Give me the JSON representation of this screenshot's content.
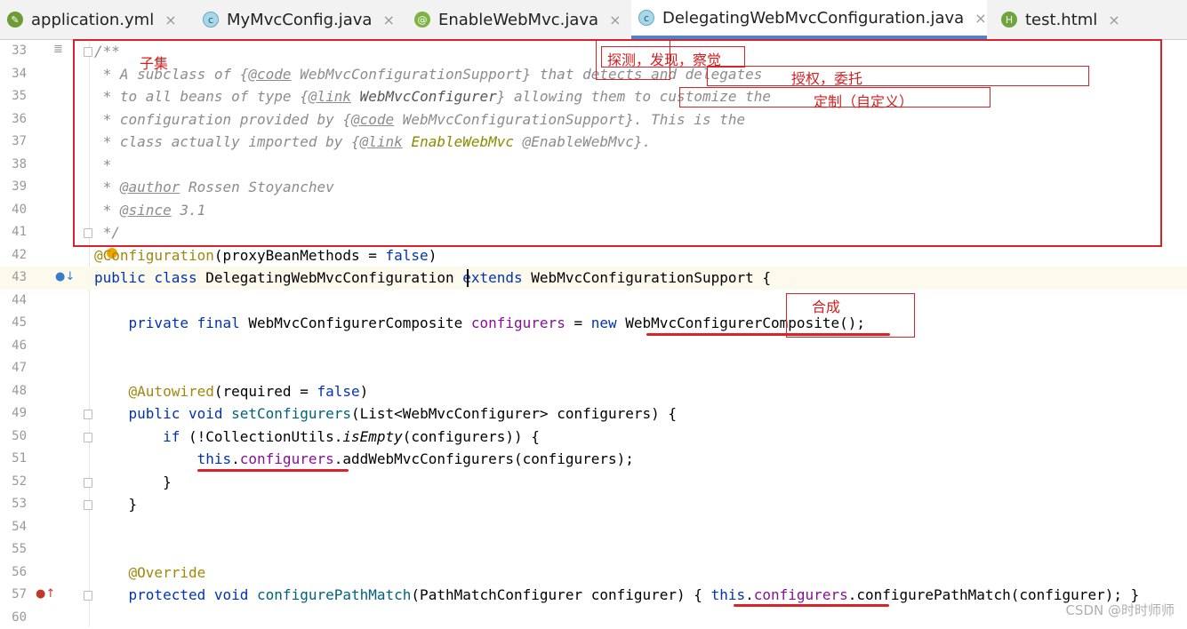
{
  "tabs": [
    {
      "label": "application.yml",
      "icon": "yml-file-icon"
    },
    {
      "label": "MyMvcConfig.java",
      "icon": "class-icon"
    },
    {
      "label": "EnableWebMvc.java",
      "icon": "annotation-icon"
    },
    {
      "label": "DelegatingWebMvcConfiguration.java",
      "icon": "class-icon",
      "active": true
    },
    {
      "label": "test.html",
      "icon": "html-file-icon"
    }
  ],
  "close_symbol": "×",
  "line_numbers": [
    "33",
    "34",
    "35",
    "36",
    "37",
    "38",
    "39",
    "40",
    "41",
    "42",
    "43",
    "44",
    "45",
    "46",
    "47",
    "48",
    "49",
    "50",
    "51",
    "52",
    "53",
    "54",
    "55",
    "56",
    "57",
    "60"
  ],
  "code": {
    "l33": "/**",
    "l34_a": " * A subclass of {",
    "l34_tag": "@code",
    "l34_b": " WebMvcConfigurationSupport} that detects and delegates",
    "l35_a": " * to all beans of type {",
    "l35_tag": "@link",
    "l35_sp": " ",
    "l35_link": "WebMvcConfigurer",
    "l35_b": "} allowing them to customize the",
    "l36_a": " * configuration provided by {",
    "l36_tag": "@code",
    "l36_b": " WebMvcConfigurationSupport}. This is the",
    "l37_a": " * class actually imported by {",
    "l37_tag": "@link",
    "l37_sp": " ",
    "l37_link": "EnableWebMvc",
    "l37_b": " @EnableWebMvc}.",
    "l38": " *",
    "l39_a": " * ",
    "l39_tag": "@author",
    "l39_b": " Rossen Stoyanchev",
    "l40_a": " * ",
    "l40_tag": "@since",
    "l40_b": " 3.1",
    "l41": " */",
    "l42_anno": "@Configuration",
    "l42_a": "(proxyBeanMethods = ",
    "l42_kw": "false",
    "l42_b": ")",
    "l43_kw1": "public class",
    "l43_name": " DelegatingWebMvcConfiguration ",
    "l43_kw2": "extends",
    "l43_b": " WebMvcConfigurationSupport {",
    "l45_kw": "    private final",
    "l45_a": " WebMvcConfigurerComposite ",
    "l45_field": "configurers",
    "l45_b": " = ",
    "l45_kw2": "new",
    "l45_c": " WebMvcConfigurerComposite();",
    "l48_anno": "    @Autowired",
    "l48_a": "(required = ",
    "l48_kw": "false",
    "l48_b": ")",
    "l49_kw": "    public void",
    "l49_sp": " ",
    "l49_method": "setConfigurers",
    "l49_b": "(List<WebMvcConfigurer> configurers) {",
    "l50_kw": "        if",
    "l50_a": " (!CollectionUtils.",
    "l50_m": "isEmpty",
    "l50_b": "(configurers)) {",
    "l51_kw": "            this",
    "l51_dot": ".",
    "l51_field": "configurers",
    "l51_b": ".addWebMvcConfigurers(configurers);",
    "l52": "        }",
    "l53": "    }",
    "l56_anno": "    @Override",
    "l57_kw": "    protected void",
    "l57_sp": " ",
    "l57_method": "configurePathMatch",
    "l57_a": "(PathMatchConfigurer configurer) { ",
    "l57_kw2": "this",
    "l57_dot": ".",
    "l57_field": "configurers",
    "l57_b": ".configurePathMatch(configurer); }"
  },
  "notes": {
    "subset": "子集",
    "detect": "探测，发现，察觉",
    "delegate": "授权，委托",
    "customize": "定制（自定义）",
    "composite": "合成"
  },
  "watermark": "CSDN @时时师师",
  "colors": {
    "keyword": "#0033b3",
    "annotation": "#9e880d",
    "field": "#871094",
    "method": "#00627a",
    "comment": "#8c8c8c",
    "annotation_red": "#d9232a",
    "active_tab_underline": "#4a86c8"
  }
}
